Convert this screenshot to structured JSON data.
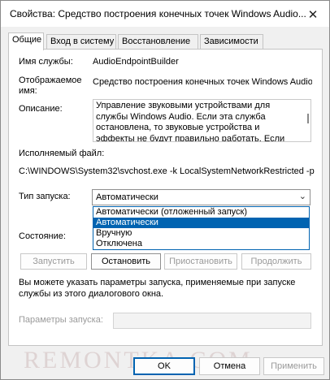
{
  "window": {
    "title": "Свойства: Средство построения конечных точек Windows Audio..."
  },
  "tabs": [
    {
      "label": "Общие"
    },
    {
      "label": "Вход в систему"
    },
    {
      "label": "Восстановление"
    },
    {
      "label": "Зависимости"
    }
  ],
  "general": {
    "service_name_label": "Имя службы:",
    "service_name_value": "AudioEndpointBuilder",
    "display_name_label_line1": "Отображаемое",
    "display_name_label_line2": "имя:",
    "display_name_value": "Средство построения конечных точек Windows Audio",
    "description_label": "Описание:",
    "description_value": "Управление звуковыми устройствами для службы Windows Audio.  Если эта служба остановлена, то звуковые устройства и эффекты не будут правильно работать.  Если",
    "executable_label": "Исполняемый файл:",
    "executable_value": "C:\\WINDOWS\\System32\\svchost.exe -k LocalSystemNetworkRestricted -p",
    "startup_type_label": "Тип запуска:",
    "startup_type_value": "Автоматически",
    "startup_options": [
      "Автоматически (отложенный запуск)",
      "Автоматически",
      "Вручную",
      "Отключена"
    ],
    "selected_option_index": 1,
    "status_label": "Состояние:",
    "buttons": {
      "start": "Запустить",
      "stop": "Остановить",
      "pause": "Приостановить",
      "resume": "Продолжить"
    },
    "hint_line1": "Вы можете указать параметры запуска, применяемые при запуске",
    "hint_line2": "службы из этого диалогового окна.",
    "params_label": "Параметры запуска:",
    "params_value": ""
  },
  "watermark": "REMONTKA.COM",
  "dialog_buttons": {
    "ok": "OK",
    "cancel": "Отмена",
    "apply": "Применить"
  },
  "colors": {
    "accent": "#0063b1",
    "panel_bg": "#ffffff",
    "window_bg": "#f0f0f0"
  }
}
